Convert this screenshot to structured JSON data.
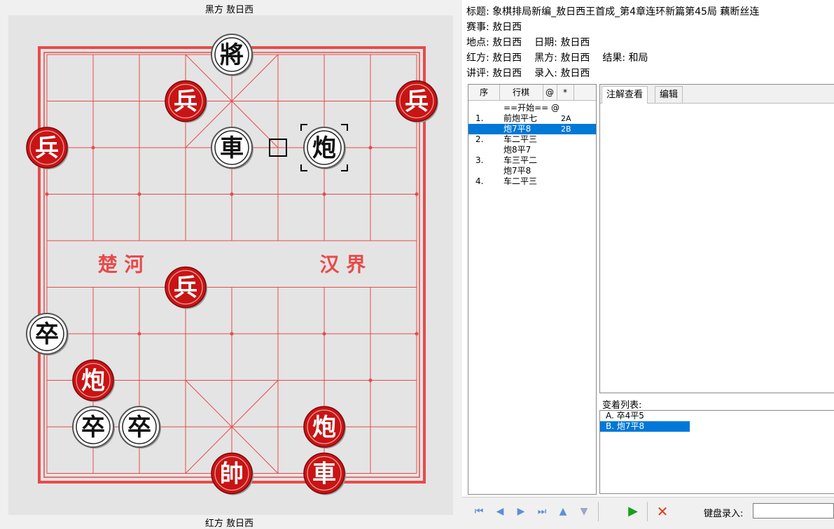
{
  "board": {
    "top_label": "黑方 敖日西",
    "bottom_label": "红方 敖日西",
    "river_left": "楚 河",
    "river_right": "汉 界",
    "colors": {
      "line": "#e84a4a",
      "red_piece": "#c81414",
      "black_piece": "#111111",
      "board_bg": "#e4e4e4"
    },
    "pieces": [
      {
        "char": "將",
        "side": "black",
        "col": 4,
        "row": 0
      },
      {
        "char": "兵",
        "side": "red",
        "col": 3,
        "row": 1
      },
      {
        "char": "兵",
        "side": "red",
        "col": 8,
        "row": 1
      },
      {
        "char": "兵",
        "side": "red",
        "col": 0,
        "row": 2
      },
      {
        "char": "車",
        "side": "black",
        "col": 4,
        "row": 2
      },
      {
        "char": "炮",
        "side": "black",
        "col": 6,
        "row": 2,
        "selected": true
      },
      {
        "char": "兵",
        "side": "red",
        "col": 3,
        "row": 5
      },
      {
        "char": "卒",
        "side": "black",
        "col": 0,
        "row": 6
      },
      {
        "char": "炮",
        "side": "red",
        "col": 1,
        "row": 7
      },
      {
        "char": "卒",
        "side": "black",
        "col": 1,
        "row": 8
      },
      {
        "char": "卒",
        "side": "black",
        "col": 2,
        "row": 8
      },
      {
        "char": "炮",
        "side": "red",
        "col": 6,
        "row": 8
      },
      {
        "char": "帥",
        "side": "red",
        "col": 4,
        "row": 9
      },
      {
        "char": "車",
        "side": "red",
        "col": 6,
        "row": 9
      }
    ],
    "last_move_from": {
      "col": 5,
      "row": 2
    }
  },
  "meta": {
    "title": "标题: 象棋排局新编_敖日西王首成_第4章连环新篇第45局 藕断丝连",
    "event": "赛事: 敖日西",
    "place": "地点: 敖日西",
    "date": "日期: 敖日西",
    "red": "红方: 敖日西",
    "black": "黑方: 敖日西",
    "result": "结果: 和局",
    "commentator": "讲评: 敖日西",
    "recorder": "录入: 敖日西"
  },
  "moves_header": {
    "seq": "序",
    "move": "行棋",
    "at": "@",
    "star": "*"
  },
  "moves": [
    {
      "num": "",
      "text": "==开始== @",
      "mark": ""
    },
    {
      "num": "1.",
      "text": "前炮平七",
      "mark": "2A"
    },
    {
      "num": "",
      "text": "炮7平8",
      "mark": "2B",
      "selected": true
    },
    {
      "num": "2.",
      "text": "车二平三",
      "mark": ""
    },
    {
      "num": "",
      "text": "炮8平7",
      "mark": ""
    },
    {
      "num": "3.",
      "text": "车三平二",
      "mark": ""
    },
    {
      "num": "",
      "text": "炮7平8",
      "mark": ""
    },
    {
      "num": "4.",
      "text": "车二平三",
      "mark": ""
    }
  ],
  "tabs": [
    {
      "label": "注解查看",
      "active": true
    },
    {
      "label": "编辑",
      "active": false
    }
  ],
  "variations_label": "变着列表:",
  "variations": [
    {
      "text": "A. 卒4平5",
      "selected": false
    },
    {
      "text": "B. 炮7平8",
      "selected": true
    }
  ],
  "toolbar": {
    "first_icon": "skip-first-icon",
    "prev_icon": "prev-icon",
    "next_icon": "next-icon",
    "last_icon": "skip-last-icon",
    "up_icon": "up-icon",
    "down_icon": "down-icon",
    "play_icon": "play-icon",
    "delete_icon": "delete-icon",
    "keyboard_label": "键盘录入:"
  }
}
